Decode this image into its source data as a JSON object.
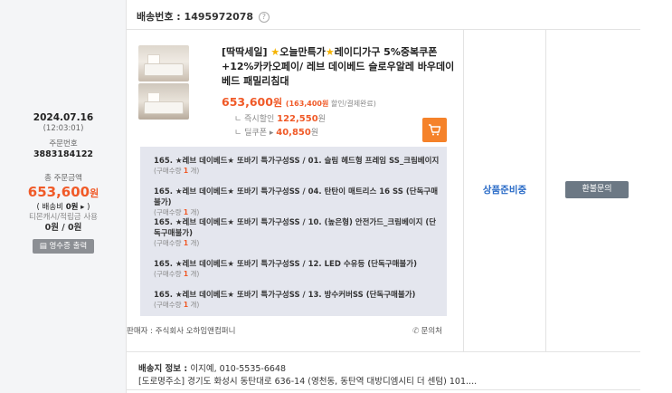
{
  "order": {
    "date": "2024.07.16",
    "time": "(12:03:01)",
    "order_no_label": "주문번호",
    "order_no": "3883184122",
    "total_label": "총 주문금액",
    "total_amount": "653,600",
    "total_unit": "원",
    "ship_fee_prefix": "( 배송비 ",
    "ship_fee_value": "0원",
    "ship_fee_suffix": " ▸ )",
    "cash_label": "티몬캐시/적립금 사용",
    "cash_value": "0원 / 0원",
    "receipt_label": "영수증 출력"
  },
  "shipping": {
    "label": "배송번호 : 1495972078",
    "help": "?"
  },
  "product": {
    "title_part1": "[딱딱세일] ",
    "title_part2": "오늘만특가",
    "title_part3": "레이디가구 5%중복쿠폰+12%카카오페이/ 레브 데이베드 슬로우알레 바우데이베드 패밀리침대",
    "price_main": "653,600",
    "price_unit": "원",
    "price_paren_value": "(163,400원",
    "price_paren_rest": " 할인/결제완료)",
    "instant_label": "ㄴ 즉시할인 ",
    "instant_value": "122,550",
    "instant_unit": "원",
    "coupon_label": "ㄴ 딜쿠폰 ▸ ",
    "coupon_value": "40,850",
    "coupon_unit": "원"
  },
  "options": [
    {
      "name": "165. ★레브 데이베드★ 또바기 특가구성SS / 01. 슬림 헤드형 프레임 SS_크림베이지",
      "qty_prefix": "(구매수량 ",
      "qty": "1",
      "qty_suffix": " 개)"
    },
    {
      "name": "165. ★레브 데이베드★ 또바기 특가구성SS / 04. 탄탄이 매트리스 16 SS (단독구매불가)",
      "qty_prefix": "(구매수량 ",
      "qty": "1",
      "qty_suffix": " 개)"
    },
    {
      "name": "165. ★레브 데이베드★ 또바기 특가구성SS / 10. (높은형) 안전가드_크림베이지 (단독구매불가)",
      "qty_prefix": "(구매수량 ",
      "qty": "1",
      "qty_suffix": " 개)"
    },
    {
      "name": "165. ★레브 데이베드★ 또바기 특가구성SS / 12. LED 수유등 (단독구매불가)",
      "qty_prefix": "(구매수량 ",
      "qty": "1",
      "qty_suffix": " 개)"
    },
    {
      "name": "165. ★레브 데이베드★ 또바기 특가구성SS / 13. 방수커버SS (단독구매불가)",
      "qty_prefix": "(구매수량 ",
      "qty": "1",
      "qty_suffix": " 개)"
    }
  ],
  "seller": {
    "label": "판매자 : 주식회사 오하임앤컴퍼니",
    "inquiry": "문의처"
  },
  "status": {
    "text": "상품준비중",
    "refund_button": "환불문의"
  },
  "address": {
    "label": "배송지 정보 : ",
    "recipient": "이지예, 010-5535-6648",
    "road": "[도로명주소] 경기도 화성시 동탄대로 636-14 (영천동, 동탄역 대방디엠시티 더 센텀) 101...."
  },
  "colors": {
    "accent": "#f05a28",
    "status_blue": "#2a6bc7",
    "option_bg": "#e4e6ee",
    "left_bg": "#f4f5f7"
  }
}
